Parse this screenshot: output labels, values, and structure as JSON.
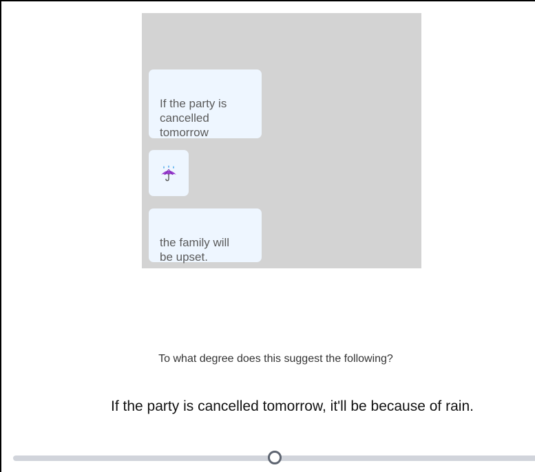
{
  "chat": {
    "messages": [
      {
        "text": "If the party is\ncancelled\ntomorrow"
      },
      {
        "icon": "umbrella-with-rain-drops-icon"
      },
      {
        "text": "the family will\nbe upset."
      }
    ]
  },
  "survey": {
    "question": "To what degree does this suggest the following?",
    "statement": "If the party is cancelled tomorrow, it'll be because of rain."
  },
  "slider": {
    "value_fraction": 0.5
  },
  "colors": {
    "panel": "#d3d3d3",
    "bubble": "#eef6ff",
    "bubble_text": "#5a5a5a",
    "slider_track": "#d1d4db",
    "slider_thumb_border": "#5d6470"
  }
}
